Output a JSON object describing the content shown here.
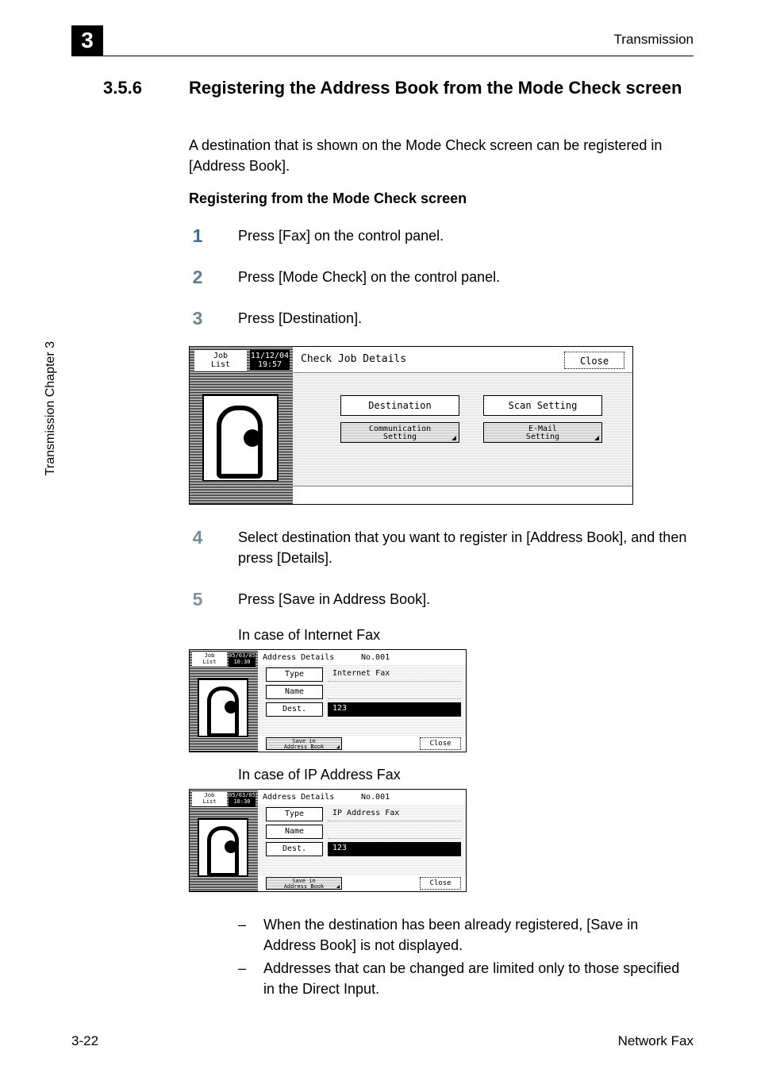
{
  "header": {
    "chapter_number": "3",
    "section_title": "Transmission"
  },
  "sidebar": {
    "text": "Transmission          Chapter 3"
  },
  "heading": {
    "number": "3.5.6",
    "title": "Registering the Address Book from the Mode Check screen"
  },
  "intro": "A destination that is shown on the Mode Check screen can be registered in [Address Book].",
  "subheading": "Registering from the Mode Check screen",
  "steps": {
    "s1": "Press [Fax] on the control panel.",
    "s2": "Press [Mode Check] on the control panel.",
    "s3": "Press [Destination].",
    "s4": "Select destination that you want to register in [Address Book], and then press [Details].",
    "s5": "Press [Save in Address Book]."
  },
  "captions": {
    "c1": "In case of Internet Fax",
    "c2": "In case of IP Address Fax"
  },
  "notes": {
    "n1": "When the destination has been already registered, [Save in Address Book] is not displayed.",
    "n2": "Addresses that can be changed are limited only to those specified in the Direct Input."
  },
  "footer": {
    "left": "3-22",
    "right": "Network Fax"
  },
  "shot1": {
    "job_list": "Job\nList",
    "datetime": "11/12/04\n19:57",
    "title": "Check Job Details",
    "close": "Close",
    "btn_destination": "Destination",
    "btn_scan": "Scan Setting",
    "btn_comm": "Communication\nSetting",
    "btn_email": "E-Mail\nSetting"
  },
  "shot_sm_common": {
    "job_list": "Job\nList",
    "datetime": "05/03/05\n10:30",
    "ad_title": "Address Details",
    "no": "No.001",
    "label_type": "Type",
    "label_name": "Name",
    "label_dest": "Dest.",
    "dest_val": "123",
    "save_btn": "Save in\nAddress Book",
    "close": "Close"
  },
  "shot_sm1": {
    "type_val": "Internet Fax"
  },
  "shot_sm2": {
    "type_val": "IP Address Fax"
  }
}
